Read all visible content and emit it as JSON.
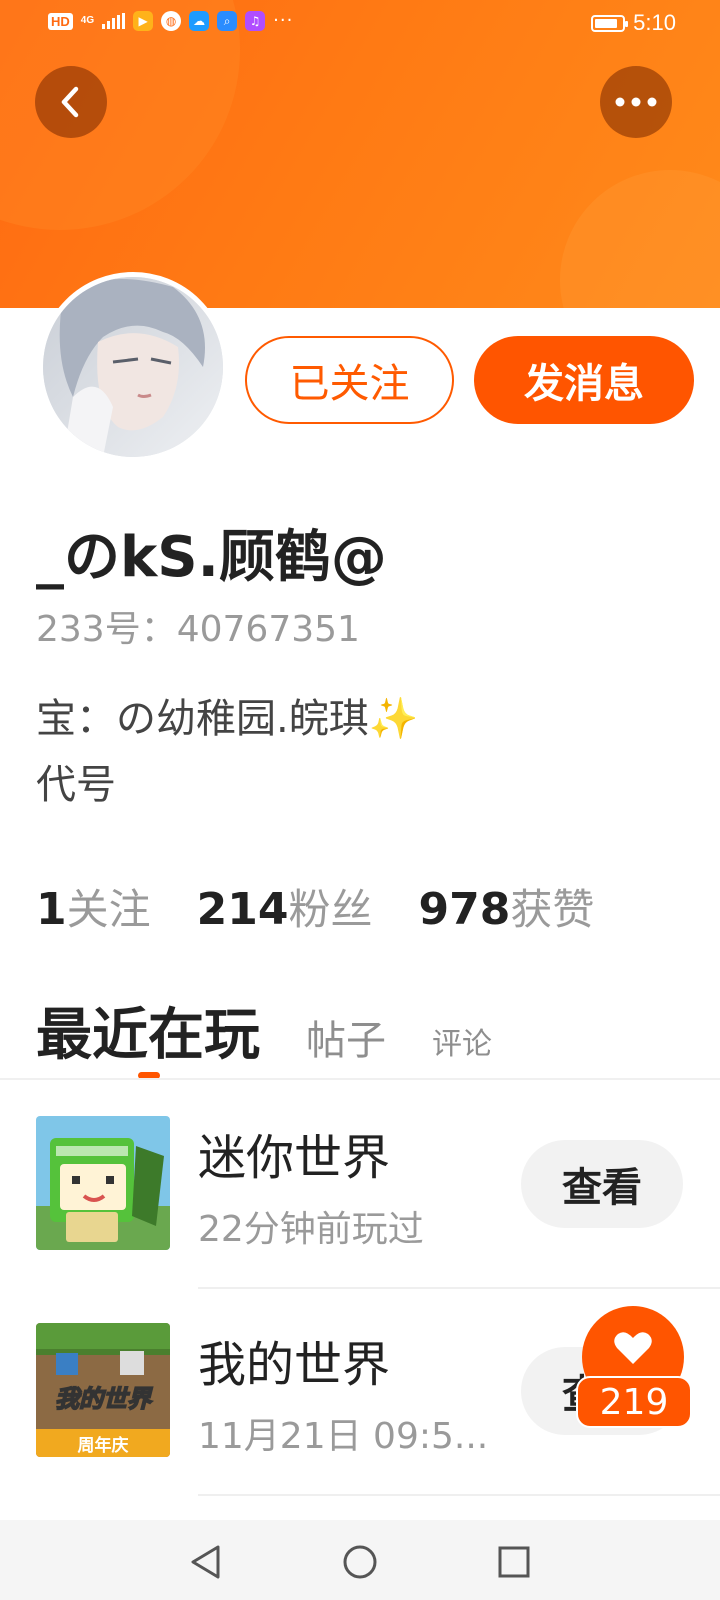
{
  "status_bar": {
    "network": "HD",
    "signal": "4G",
    "time": "5:10",
    "battery_level": 0.85,
    "app_icons": [
      "video-app-icon",
      "ball-app-icon",
      "cloud-app-icon",
      "search-app-icon",
      "music-app-icon"
    ]
  },
  "header": {
    "back_icon": "chevron-left-icon",
    "more_icon": "more-dots-icon"
  },
  "actions": {
    "follow_label": "已关注",
    "message_label": "发消息"
  },
  "profile": {
    "username": "_のkS.顾鹤@",
    "id_text": "233号：40767351",
    "bio_line1": "宝：の幼稚园.皖琪",
    "bio_sparkle": "✨",
    "bio_line2": "代号"
  },
  "stats": [
    {
      "num": "1",
      "label": "关注"
    },
    {
      "num": "214",
      "label": "粉丝"
    },
    {
      "num": "978",
      "label": "获赞"
    }
  ],
  "tabs": {
    "active": "最近在玩",
    "second": "帖子",
    "third": "评论"
  },
  "games": [
    {
      "name": "迷你世界",
      "when": "22分钟前玩过",
      "button": "查看"
    },
    {
      "name": "我的世界",
      "when": "11月21日 09:5...",
      "button": "查看",
      "icon_title": "我的世界",
      "icon_subtitle": "周年庆"
    }
  ],
  "like_fab": {
    "icon": "heart-icon",
    "count": "219"
  },
  "colors": {
    "accent": "#ff5500",
    "banner": "#ff7a14"
  }
}
